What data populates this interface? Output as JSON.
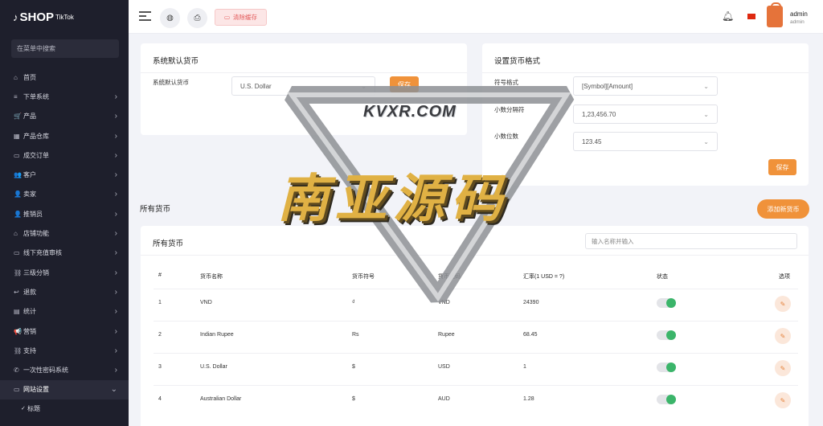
{
  "logo": {
    "note": "♪",
    "brand": "SHOP",
    "sub": "TikTok"
  },
  "sidebar": {
    "search_placeholder": "在菜单中搜索",
    "items": [
      {
        "icon": "⌂",
        "label": "首页",
        "chevron": ""
      },
      {
        "icon": "≡",
        "label": "下单系统",
        "chevron": "›"
      },
      {
        "icon": "🛒",
        "label": "产品",
        "chevron": "›"
      },
      {
        "icon": "▦",
        "label": "产品仓库",
        "chevron": "›"
      },
      {
        "icon": "▭",
        "label": "成交订单",
        "chevron": "›"
      },
      {
        "icon": "👥",
        "label": "客户",
        "chevron": "›"
      },
      {
        "icon": "👤",
        "label": "卖家",
        "chevron": "›"
      },
      {
        "icon": "👤",
        "label": "推销员",
        "chevron": "›"
      },
      {
        "icon": "⌂",
        "label": "店铺功能",
        "chevron": "›"
      },
      {
        "icon": "▭",
        "label": "线下充值审核",
        "chevron": "›"
      },
      {
        "icon": "⛓",
        "label": "三级分销",
        "chevron": "›"
      },
      {
        "icon": "↩",
        "label": "退款",
        "chevron": "›"
      },
      {
        "icon": "▤",
        "label": "统计",
        "chevron": "›"
      },
      {
        "icon": "📢",
        "label": "营销",
        "chevron": "›"
      },
      {
        "icon": "⛓",
        "label": "支持",
        "chevron": "›"
      },
      {
        "icon": "✆",
        "label": "一次性密码系统",
        "chevron": "›"
      },
      {
        "icon": "▭",
        "label": "网站设置",
        "chevron": "⌄"
      }
    ],
    "sub_items": [
      {
        "label": "标题"
      }
    ]
  },
  "topbar": {
    "clear_cache": "清除缓存",
    "admin_name": "admin",
    "admin_role": "admin"
  },
  "default_currency": {
    "title": "系统默认货币",
    "label": "系统默认货币",
    "value": "U.S. Dollar",
    "save": "保存"
  },
  "currency_format": {
    "title": "设置货币格式",
    "symbol_label": "符号格式",
    "symbol_value": "[Symbol][Amount]",
    "decimal_sep_label": "小数分隔符",
    "decimal_sep_value": "1,23,456.70",
    "decimals_label": "小数位数",
    "decimals_value": "123.45",
    "save": "保存"
  },
  "all_currencies": {
    "section_title": "所有货币",
    "card_title": "所有货币",
    "add_button": "添加新货币",
    "search_placeholder": "输入名称并输入",
    "headers": [
      "#",
      "货币名称",
      "货币符号",
      "货币代码",
      "汇率(1 USD = ?)",
      "状态",
      "选项"
    ],
    "rows": [
      {
        "no": "1",
        "name": "VND",
        "symbol": "₫",
        "code": "VND",
        "rate": "24390",
        "enabled": true
      },
      {
        "no": "2",
        "name": "Indian Rupee",
        "symbol": "Rs",
        "code": "Rupee",
        "rate": "68.45",
        "enabled": true
      },
      {
        "no": "3",
        "name": "U.S. Dollar",
        "symbol": "$",
        "code": "USD",
        "rate": "1",
        "enabled": true
      },
      {
        "no": "4",
        "name": "Australian Dollar",
        "symbol": "$",
        "code": "AUD",
        "rate": "1.28",
        "enabled": true
      }
    ]
  },
  "watermark": {
    "site": "KVXR.COM",
    "text": "南亚源码"
  },
  "colors": {
    "accent": "#f0923a",
    "sidebar_bg": "#1e1f2c",
    "toggle_on": "#3bb56a",
    "danger": "#e35b5b"
  },
  "icons": {
    "globe": "globe-icon",
    "print": "printer-icon",
    "bell": "bell-icon",
    "edit": "edit-icon"
  }
}
